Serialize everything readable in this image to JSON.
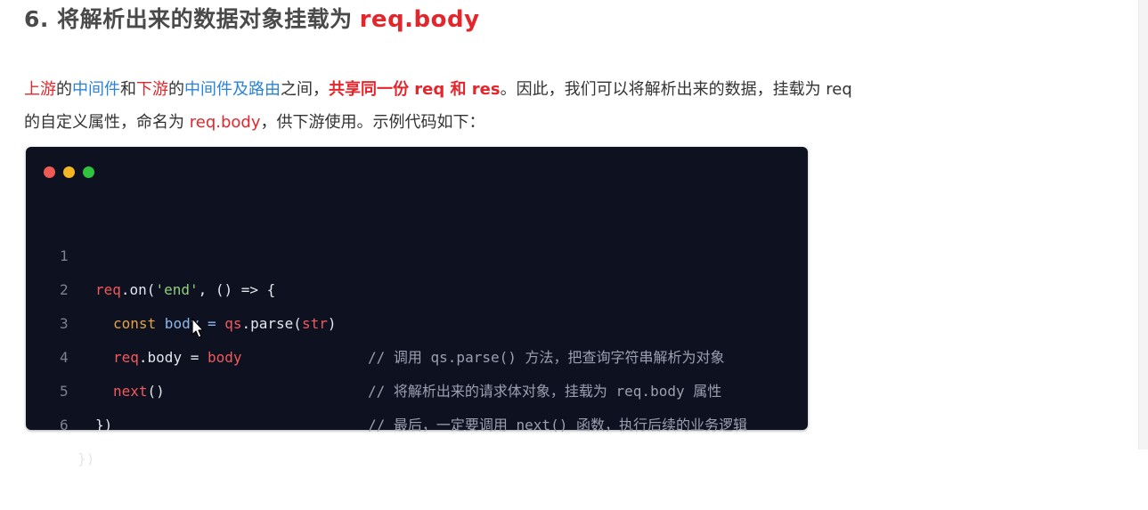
{
  "heading": {
    "number_title": "6. 将解析出来的数据对象挂载为",
    "highlight": "req.body"
  },
  "paragraph": {
    "seg1": "上游",
    "seg2": "的",
    "seg3": "中间件",
    "seg4": "和",
    "seg5": "下游",
    "seg6": "的",
    "seg7": "中间件及路由",
    "seg8": "之间，",
    "seg9": "共享同一份 req 和 res",
    "seg10": "。因此，我们可以将解析出来的数据，挂载为 req",
    "seg11": "的自定义属性，命名为 ",
    "seg12": "req.body",
    "seg13": "，供下游使用。示例代码如下："
  },
  "code": {
    "dot_colors": [
      "#ee5b56",
      "#f4b622",
      "#2fc340"
    ],
    "lines": [
      {
        "num": "1",
        "t1": "req",
        "t2": ".on(",
        "t3": "'end'",
        "t4": ", () => {",
        "comment": ""
      },
      {
        "num": "2",
        "t1": "const",
        "t2": " body = ",
        "t3": "qs",
        "t4": ".parse(",
        "t5": "str",
        "t6": ")",
        "comment": "// 调用 qs.parse() 方法，把查询字符串解析为对象"
      },
      {
        "num": "3",
        "t1": "req",
        "t2": ".body = ",
        "t3": "body",
        "comment": "// 将解析出来的请求体对象，挂载为 req.body 属性"
      },
      {
        "num": "4",
        "t1": "next",
        "t2": "()",
        "comment": "// 最后，一定要调用 next() 函数，执行后续的业务逻辑"
      },
      {
        "num": "5",
        "t1": "})"
      },
      {
        "num": "6",
        "t1": "})"
      }
    ]
  }
}
